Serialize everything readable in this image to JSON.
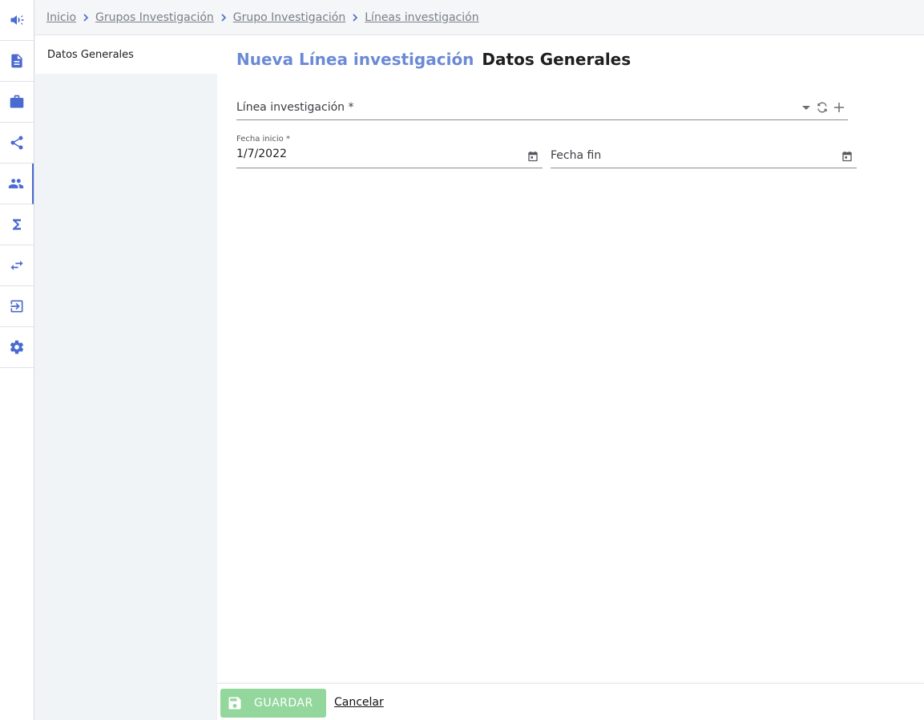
{
  "rail": {
    "items": [
      {
        "icon": "megaphone-icon"
      },
      {
        "icon": "document-icon"
      },
      {
        "icon": "briefcase-icon"
      },
      {
        "icon": "share-icon"
      },
      {
        "icon": "people-icon",
        "active": true
      },
      {
        "icon": "sigma-icon"
      },
      {
        "icon": "swap-arrows-icon"
      },
      {
        "icon": "logout-icon"
      },
      {
        "icon": "gear-icon"
      }
    ]
  },
  "breadcrumb": {
    "items": [
      "Inicio",
      "Grupos Investigación",
      "Grupo Investigación",
      "Líneas investigación"
    ]
  },
  "sections": {
    "items": [
      {
        "label": "Datos Generales"
      }
    ]
  },
  "page": {
    "title_accent": "Nueva Línea investigación",
    "title_main": "Datos Generales"
  },
  "form": {
    "linea": {
      "label": "Línea investigación *",
      "value": ""
    },
    "fecha_inicio": {
      "label": "Fecha inicio *",
      "value": "1/7/2022"
    },
    "fecha_fin": {
      "label": "Fecha fin",
      "value": ""
    }
  },
  "footer": {
    "save_label": "GUARDAR",
    "cancel_label": "Cancelar"
  },
  "colors": {
    "accent": "#4a6ad0",
    "title_accent": "#6b8ad6",
    "save_button": "#93d79d"
  }
}
